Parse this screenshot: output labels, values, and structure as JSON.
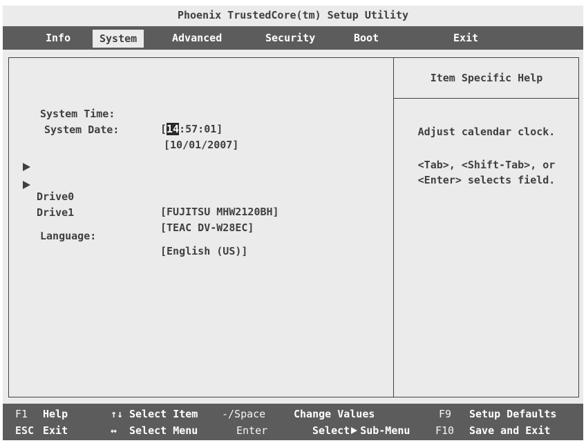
{
  "title": "Phoenix TrustedCore(tm) Setup Utility",
  "menu": {
    "items": [
      {
        "label": "Info"
      },
      {
        "label": "System"
      },
      {
        "label": "Advanced"
      },
      {
        "label": "Security"
      },
      {
        "label": "Boot"
      },
      {
        "label": "Exit"
      }
    ],
    "selected": "System"
  },
  "settings": {
    "system_time": {
      "label": "System Time:",
      "open": "[",
      "hour": "14",
      "rest": ":57:01]"
    },
    "system_date": {
      "label": "System Date:",
      "value": "[10/01/2007]"
    },
    "drive0": {
      "label": "Drive0",
      "value": "[FUJITSU MHW2120BH]",
      "icon": "submenu-arrow-icon"
    },
    "drive1": {
      "label": "Drive1",
      "value": "[TEAC DV-W28EC]",
      "icon": "submenu-arrow-icon"
    },
    "language": {
      "label": "Language:",
      "value": "[English (US)]"
    }
  },
  "help": {
    "header": "Item Specific Help",
    "line1": "Adjust calendar clock.",
    "line2": "<Tab>, <Shift-Tab>, or",
    "line3": "<Enter> selects field."
  },
  "footer": {
    "row1": [
      {
        "key": "F1",
        "desc": "Help"
      },
      {
        "key": "↑↓",
        "desc": "Select Item"
      },
      {
        "key": "-/Space",
        "desc": "Change Values"
      },
      {
        "key": "F9",
        "desc": "Setup Defaults"
      }
    ],
    "row2": [
      {
        "key": "ESC",
        "desc": "Exit"
      },
      {
        "key": "↔",
        "desc": "Select Menu"
      },
      {
        "key": "Enter",
        "desc_a": "Select",
        "desc_b": "Sub-Menu"
      },
      {
        "key": "F10",
        "desc": "Save and Exit"
      }
    ]
  },
  "colors": {
    "background": "#ebebeb",
    "bar": "#5c5c5c",
    "text": "#3f3f3f",
    "highlight": "#2a2a2a"
  }
}
